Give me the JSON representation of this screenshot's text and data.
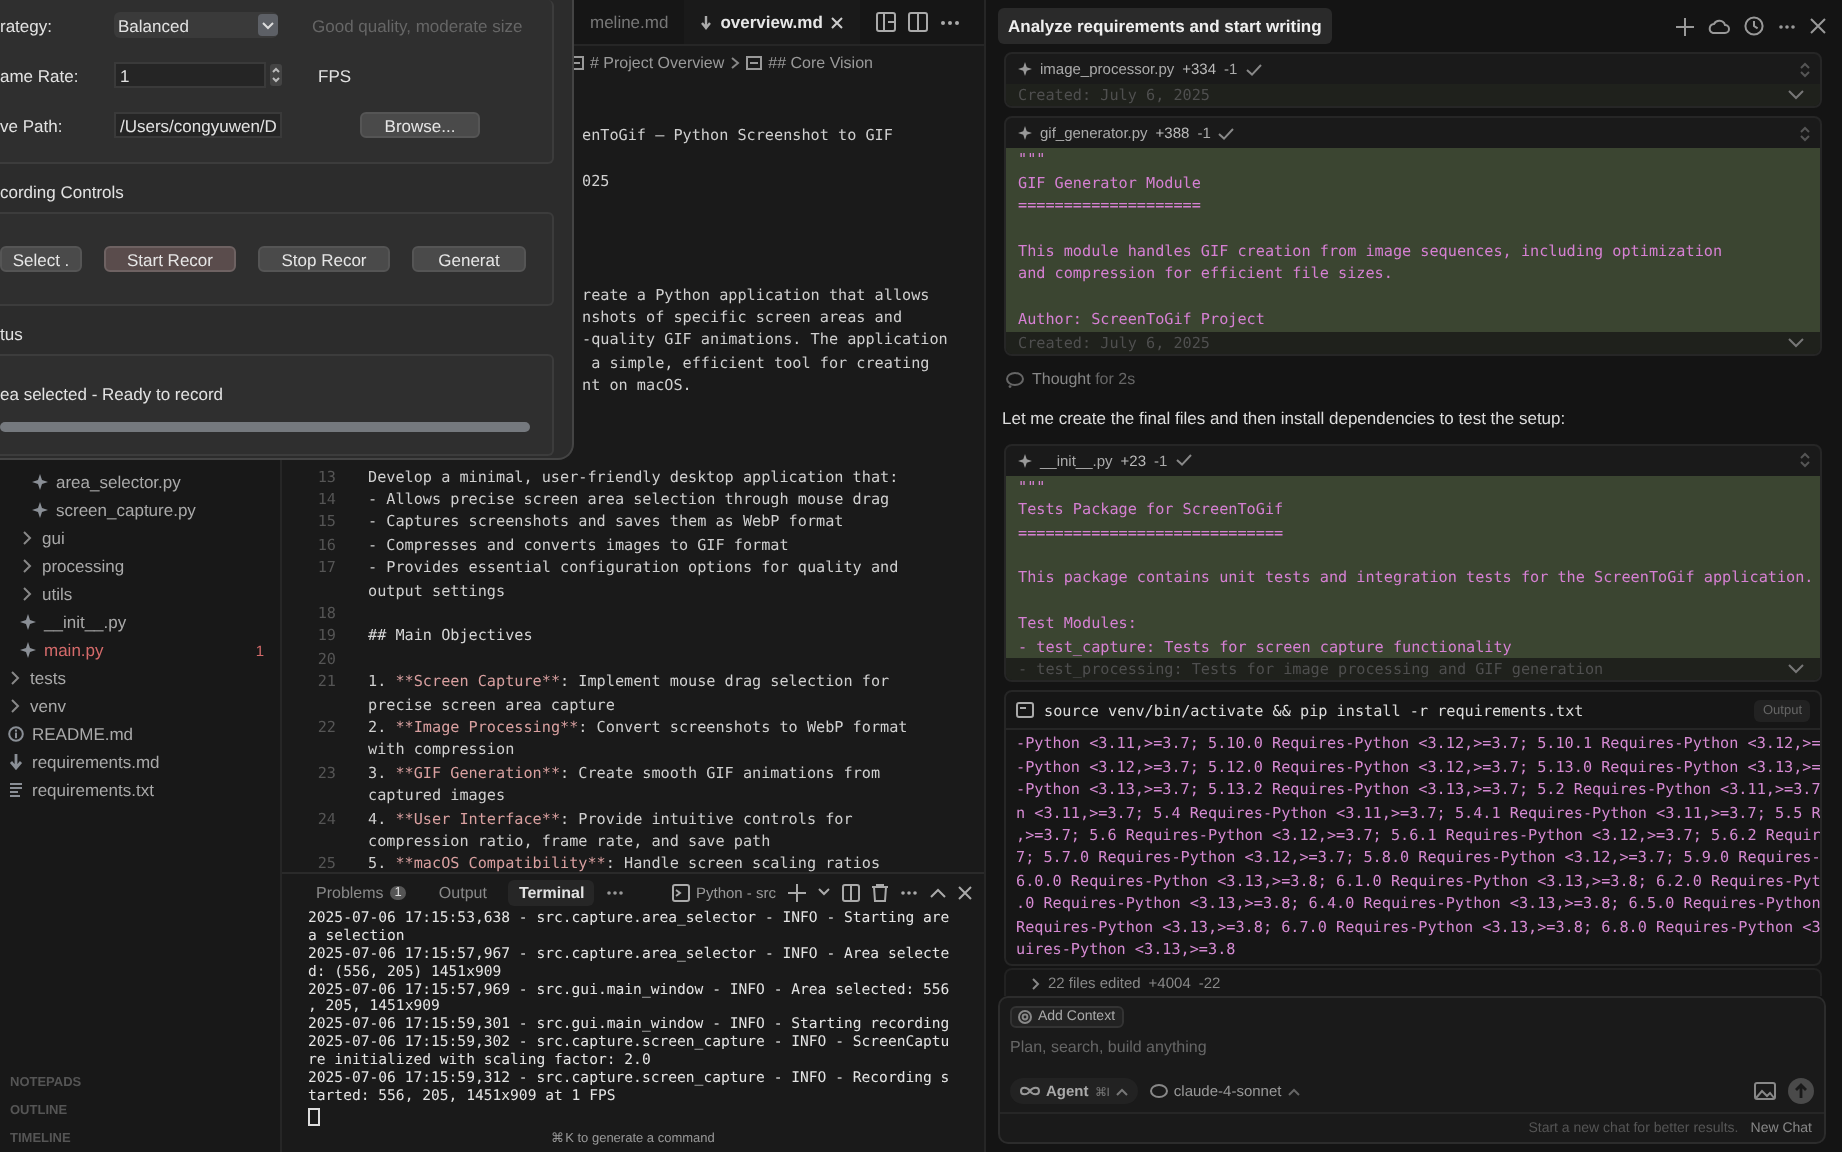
{
  "dialog": {
    "settings": [
      {
        "kind": "select",
        "label": "rategy:",
        "value": "Balanced",
        "hint": "Good quality, moderate size"
      },
      {
        "kind": "spinner",
        "label": "ame Rate:",
        "value": "1",
        "unit": "FPS"
      },
      {
        "kind": "path",
        "label": "ve Path:",
        "value": "/Users/congyuwen/D",
        "button": "Browse..."
      }
    ],
    "controls_title": "cording Controls",
    "controls": [
      {
        "label": "Select .",
        "focused": false
      },
      {
        "label": "Start Recor",
        "focused": true
      },
      {
        "label": "Stop Recor",
        "focused": false
      },
      {
        "label": "Generat",
        "focused": false
      }
    ],
    "status_title": "tus",
    "status": "ea selected - Ready to record",
    "progress": {
      "level": 1
    }
  },
  "sidebar": {
    "tree": [
      {
        "children": [
          {
            "children": [
              {
                "kind": "python",
                "label": "area_selector.py",
                "error": false
              },
              {
                "kind": "python",
                "label": "screen_capture.py",
                "error": false
              }
            ]
          },
          {
            "kind": "folder",
            "label": "gui",
            "expanded": false
          },
          {
            "kind": "folder",
            "label": "processing",
            "expanded": false
          },
          {
            "kind": "folder",
            "label": "utils",
            "expanded": false
          },
          {
            "kind": "python",
            "label": "__init__.py",
            "error": false
          },
          {
            "kind": "python",
            "label": "main.py",
            "error": true,
            "badge": "1"
          }
        ]
      },
      {
        "kind": "folder",
        "label": "tests",
        "expanded": false
      },
      {
        "kind": "folder",
        "label": "venv",
        "expanded": false
      },
      {
        "kind": "readme",
        "label": "README.md",
        "error": false
      },
      {
        "kind": "markdown",
        "label": "requirements.md",
        "error": false
      },
      {
        "kind": "text",
        "label": "requirements.txt",
        "error": false
      }
    ],
    "sections": [
      "NOTEPADS",
      "OUTLINE",
      "TIMELINE"
    ]
  },
  "editor": {
    "tabs": [
      {
        "label": "meline.md",
        "selected": false
      },
      {
        "label": "overview.md",
        "selected": true
      }
    ],
    "breadcrumb": [
      "# Project Overview",
      "## Core Vision"
    ],
    "covered_lines": [
      "enToGif – Python Screenshot to GIF",
      "025",
      "reate a Python application that allows",
      "nshots of specific screen areas and",
      "-quality GIF animations. The application",
      " a simple, efficient tool for creating",
      "nt on macOS."
    ],
    "lines": [
      {
        "num": "13",
        "parts": [
          {
            "kind": "text",
            "text": "Develop a minimal, user-friendly desktop application that:"
          }
        ]
      },
      {
        "num": "14",
        "parts": [
          {
            "kind": "text",
            "text": "- Allows precise screen area selection through mouse drag"
          }
        ]
      },
      {
        "num": "15",
        "parts": [
          {
            "kind": "text",
            "text": "- Captures screenshots and saves them as WebP format"
          }
        ]
      },
      {
        "num": "16",
        "parts": [
          {
            "kind": "text",
            "text": "- Compresses and converts images to GIF format"
          }
        ]
      },
      {
        "num": "17",
        "parts": [
          {
            "kind": "text",
            "text": "- Provides essential configuration options for quality and"
          }
        ]
      },
      {
        "parts": [
          {
            "kind": "text",
            "text": "output settings"
          }
        ]
      },
      {
        "num": "18"
      },
      {
        "num": "19",
        "parts": [
          {
            "kind": "heading",
            "text": "## Main Objectives"
          }
        ]
      },
      {
        "num": "20"
      },
      {
        "num": "21",
        "parts": [
          {
            "kind": "text",
            "text": "1. "
          },
          {
            "kind": "strong",
            "text": "**Screen Capture**"
          },
          {
            "kind": "text",
            "text": ": Implement mouse drag selection for"
          }
        ]
      },
      {
        "parts": [
          {
            "kind": "text",
            "text": "precise screen area capture"
          }
        ]
      },
      {
        "num": "22",
        "parts": [
          {
            "kind": "text",
            "text": "2. "
          },
          {
            "kind": "strong",
            "text": "**Image Processing**"
          },
          {
            "kind": "text",
            "text": ": Convert screenshots to WebP format"
          }
        ]
      },
      {
        "parts": [
          {
            "kind": "text",
            "text": "with compression"
          }
        ]
      },
      {
        "num": "23",
        "parts": [
          {
            "kind": "text",
            "text": "3. "
          },
          {
            "kind": "strong",
            "text": "**GIF Generation**"
          },
          {
            "kind": "text",
            "text": ": Create smooth GIF animations from"
          }
        ]
      },
      {
        "parts": [
          {
            "kind": "text",
            "text": "captured images"
          }
        ]
      },
      {
        "num": "24",
        "parts": [
          {
            "kind": "text",
            "text": "4. "
          },
          {
            "kind": "strong",
            "text": "**User Interface**"
          },
          {
            "kind": "text",
            "text": ": Provide intuitive controls for"
          }
        ]
      },
      {
        "parts": [
          {
            "kind": "text",
            "text": "compression ratio, frame rate, and save path"
          }
        ]
      },
      {
        "num": "25",
        "parts": [
          {
            "kind": "text",
            "text": "5. "
          },
          {
            "kind": "strong",
            "text": "**macOS Compatibility**"
          },
          {
            "kind": "text",
            "text": ": Handle screen scaling ratios"
          }
        ]
      }
    ]
  },
  "panel": {
    "tabs": [
      {
        "label": "Problems",
        "badge": "1",
        "selected": false
      },
      {
        "label": "Output",
        "selected": false
      },
      {
        "label": "Terminal",
        "selected": true
      }
    ],
    "terminal_name": "Python - src",
    "log": [
      "2025-07-06 17:15:53,638 - src.capture.area_selector - INFO - Starting are",
      "a selection",
      "2025-07-06 17:15:57,967 - src.capture.area_selector - INFO - Area selecte",
      "d: (556, 205) 1451x909",
      "2025-07-06 17:15:57,969 - src.gui.main_window - INFO - Area selected: 556",
      ", 205, 1451x909",
      "2025-07-06 17:15:59,301 - src.gui.main_window - INFO - Starting recording",
      "2025-07-06 17:15:59,302 - src.capture.screen_capture - INFO - ScreenCaptu",
      "re initialized with scaling factor: 2.0",
      "2025-07-06 17:15:59,312 - src.capture.screen_capture - INFO - Recording s",
      "tarted: 556, 205, 1451x909 at 1 FPS"
    ],
    "hint": "⌘K to generate a command"
  },
  "chat": {
    "title": "Analyze requirements and start writing",
    "items": [
      {
        "kind": "file",
        "name": "image_processor.py",
        "added": "+334",
        "removed": "-1",
        "footer": "Created: July 6, 2025"
      },
      {
        "kind": "file",
        "name": "gif_generator.py",
        "added": "+388",
        "removed": "-1",
        "code": [
          [
            "\"\"\"",
            "GIF Generator Module",
            "===================="
          ],
          [
            "This module handles GIF creation from image sequences, including optimization",
            "and compression for efficient file sizes."
          ],
          [
            "Author: ScreenToGif Project"
          ]
        ],
        "footer": "Created: July 6, 2025"
      },
      {
        "kind": "thought",
        "label": "Thought",
        "detail": "for 2s"
      },
      {
        "kind": "text",
        "text": "Let me create the final files and then install dependencies to test the setup:"
      },
      {
        "kind": "file",
        "name": "__init__.py",
        "added": "+23",
        "removed": "-1",
        "code": [
          [
            "\"\"\"",
            "Tests Package for ScreenToGif",
            "============================="
          ],
          [
            "This package contains unit tests and integration tests for the ScreenToGif application."
          ],
          [
            "Test Modules:",
            "- test_capture: Tests for screen capture functionality"
          ]
        ],
        "footer": "- test_processing: Tests for image processing and GIF generation"
      },
      {
        "kind": "command",
        "command": "source venv/bin/activate && pip install -r requirements.txt",
        "badge": "Output",
        "output": [
          "-Python <3.11,>=3.7; 5.10.0 Requires-Python <3.12,>=3.7; 5.10.1 Requires-Python <3.12,>=",
          "-Python <3.12,>=3.7; 5.12.0 Requires-Python <3.12,>=3.7; 5.13.0 Requires-Python <3.13,>=",
          "-Python <3.13,>=3.7; 5.13.2 Requires-Python <3.13,>=3.7; 5.2 Requires-Python <3.11,>=3.7",
          "n <3.11,>=3.7; 5.4 Requires-Python <3.11,>=3.7; 5.4.1 Requires-Python <3.11,>=3.7; 5.5 R",
          ",>=3.7; 5.6 Requires-Python <3.12,>=3.7; 5.6.1 Requires-Python <3.12,>=3.7; 5.6.2 Requir",
          "7; 5.7.0 Requires-Python <3.12,>=3.7; 5.8.0 Requires-Python <3.12,>=3.7; 5.9.0 Requires-",
          "6.0.0 Requires-Python <3.13,>=3.8; 6.1.0 Requires-Python <3.13,>=3.8; 6.2.0 Requires-Pyt",
          ".0 Requires-Python <3.13,>=3.8; 6.4.0 Requires-Python <3.13,>=3.8; 6.5.0 Requires-Python",
          "Requires-Python <3.13,>=3.8; 6.7.0 Requires-Python <3.13,>=3.8; 6.8.0 Requires-Python <3",
          "uires-Python <3.13,>=3.8"
        ]
      }
    ],
    "summary": {
      "label": "22 files edited",
      "added": "+4004",
      "removed": "-22"
    },
    "composer": {
      "context_button": "Add Context",
      "placeholder": "Plan, search, build anything",
      "mode": "Agent",
      "mode_key": "⌘I",
      "model": "claude-4-sonnet"
    },
    "footer": {
      "hint": "Start a new chat for better results.",
      "button": "New Chat"
    }
  }
}
